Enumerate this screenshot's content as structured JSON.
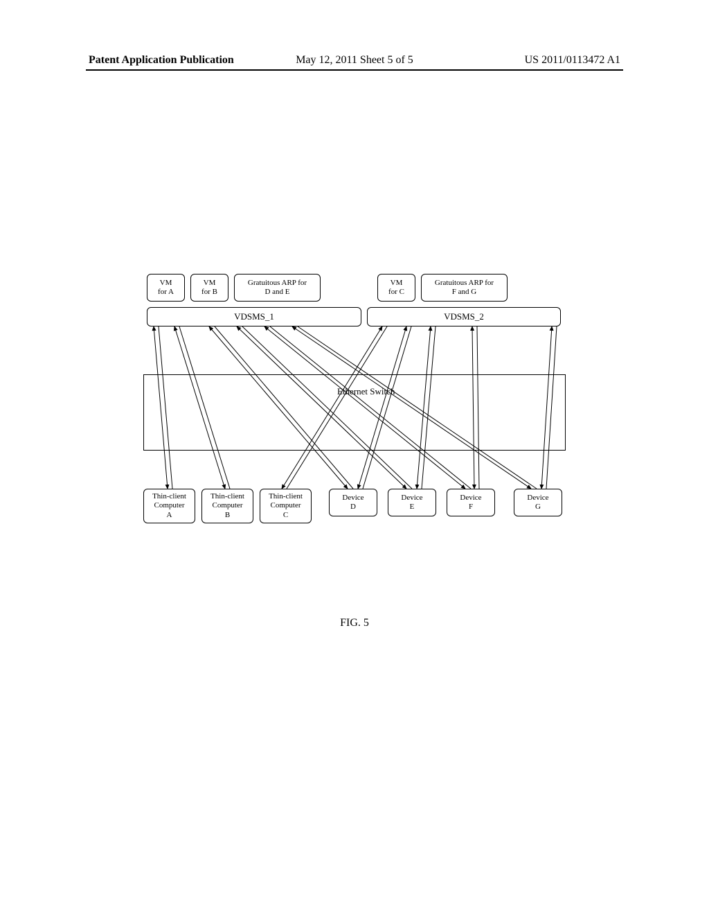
{
  "header": {
    "left": "Patent Application Publication",
    "center": "May 12, 2011  Sheet 5 of 5",
    "right": "US 2011/0113472 A1"
  },
  "diagram": {
    "vm_a": "VM\nfor A",
    "vm_b": "VM\nfor B",
    "arp_de": "Gratuitous ARP for\nD and E",
    "vm_c": "VM\nfor C",
    "arp_fg": "Gratuitous ARP for\nF and G",
    "vdsms1": "VDSMS_1",
    "vdsms2": "VDSMS_2",
    "switch": "Ethernet Switch",
    "tc_a": "Thin-client\nComputer\nA",
    "tc_b": "Thin-client\nComputer\nB",
    "tc_c": "Thin-client\nComputer\nC",
    "dev_d": "Device\nD",
    "dev_e": "Device\nE",
    "dev_f": "Device\nF",
    "dev_g": "Device\nG"
  },
  "figure_label": "FIG. 5"
}
